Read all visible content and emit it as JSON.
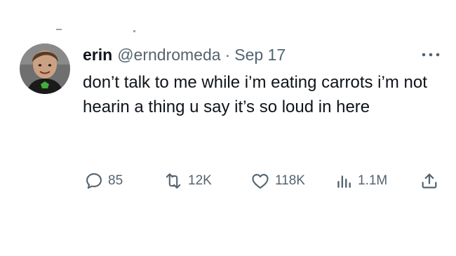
{
  "tweet": {
    "display_name": "erin",
    "handle": "@erndromeda",
    "separator": "·",
    "date": "Sep 17",
    "text": "don’t talk to me while i’m eating carrots i’m not hearin a thing u say it’s so loud in here",
    "more_icon": "more-horizontal-icon"
  },
  "metrics": {
    "replies": "85",
    "reposts": "12K",
    "likes": "118K",
    "views": "1.1M"
  },
  "icons": {
    "reply": "reply-icon",
    "repost": "repost-icon",
    "like": "heart-icon",
    "views": "views-icon",
    "share": "share-icon"
  },
  "colors": {
    "text": "#0f1419",
    "secondary": "#536471",
    "avatar_bg": "#6e6e6e"
  }
}
